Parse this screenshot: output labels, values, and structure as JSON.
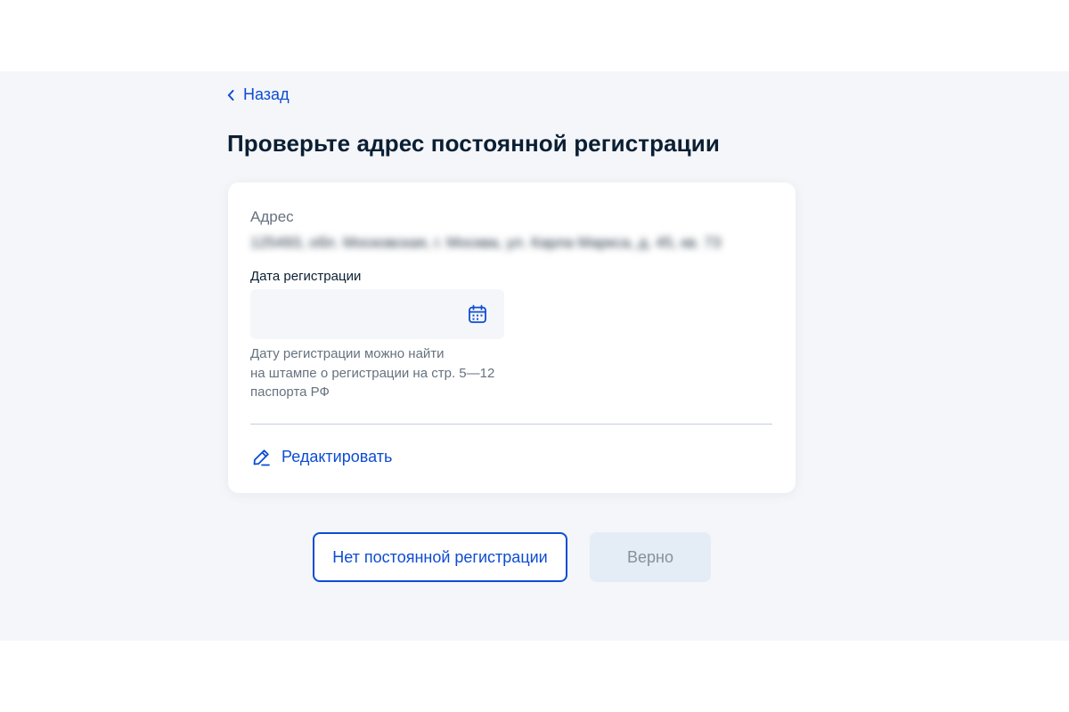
{
  "nav": {
    "back_label": "Назад",
    "back_icon": "chevron-left-icon"
  },
  "page": {
    "title": "Проверьте адрес постоянной регистрации"
  },
  "card": {
    "address_label": "Адрес",
    "address_value": "125493, обл. Московская, г. Москва, ул. Карла Маркса, д. 45, кв. 73",
    "date_label": "Дата регистрации",
    "date_value": "",
    "date_icon": "calendar-icon",
    "hint_lines": [
      "Дату регистрации можно найти",
      "на штампе о регистрации на стр. 5—12",
      "паспорта РФ"
    ],
    "edit_label": "Редактировать",
    "edit_icon": "pencil-icon"
  },
  "actions": {
    "no_registration_label": "Нет постоянной регистрации",
    "confirm_label": "Верно",
    "confirm_enabled": false
  },
  "colors": {
    "accent": "#0d4cd3",
    "page_background": "#f4f6fa",
    "text_primary": "#0b1f33",
    "text_secondary": "#66727f",
    "disabled_button": "#e4ecf5"
  }
}
